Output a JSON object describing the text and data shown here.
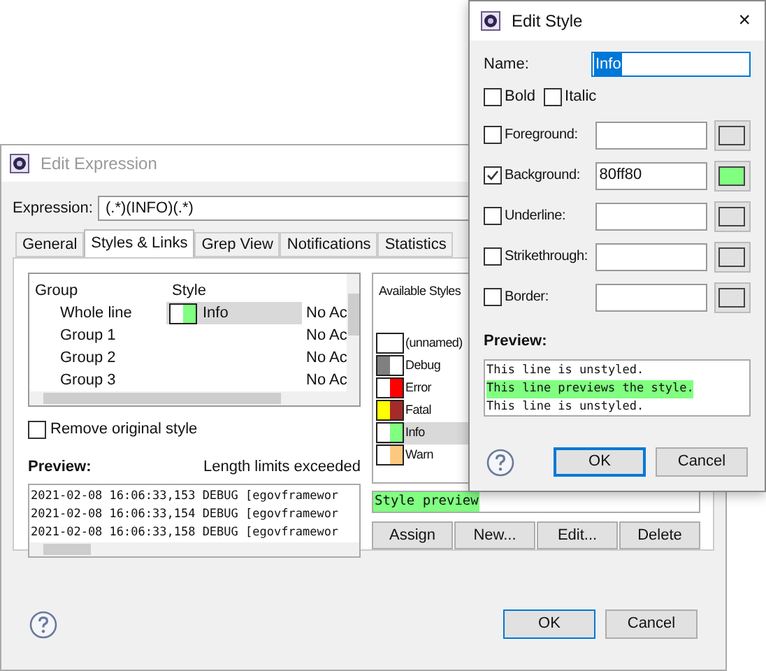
{
  "edit_expression": {
    "title": "Edit Expression",
    "expression_label": "Expression:",
    "expression_value": "(.*)(INFO)(.*)",
    "tabs": [
      {
        "label": "General",
        "selected": false
      },
      {
        "label": "Styles & Links",
        "selected": true
      },
      {
        "label": "Grep View",
        "selected": false
      },
      {
        "label": "Notifications",
        "selected": false
      },
      {
        "label": "Statistics",
        "selected": false
      }
    ],
    "groups_table": {
      "columns": [
        "Group",
        "Style"
      ],
      "rows": [
        {
          "group": "Whole line",
          "style": "Info",
          "swatch": [
            {
              "color": "#ffffff"
            },
            {
              "color": "#80ff80"
            }
          ],
          "column_3": "No Ac",
          "selected": true
        },
        {
          "group": "Group 1",
          "column_3": "No Ac",
          "selected": false
        },
        {
          "group": "Group 2",
          "column_3": "No Ac",
          "selected": false
        },
        {
          "group": "Group 3",
          "column_3": "No Ac",
          "selected": false
        }
      ]
    },
    "available_styles": {
      "title": "Available Styles",
      "items": [
        {
          "name": "(unnamed)",
          "swatch": [
            {
              "color": "#ffffff"
            },
            {
              "color": "#ffffff"
            }
          ],
          "selected": false
        },
        {
          "name": "Debug",
          "swatch": [
            {
              "color": "#808080"
            },
            {
              "color": "#ffffff"
            }
          ],
          "selected": false
        },
        {
          "name": "Error",
          "swatch": [
            {
              "color": "#ffffff"
            },
            {
              "color": "#ff0000"
            }
          ],
          "selected": false
        },
        {
          "name": "Fatal",
          "swatch": [
            {
              "color": "#ffff00"
            },
            {
              "color": "#a52a2a"
            }
          ],
          "selected": false
        },
        {
          "name": "Info",
          "swatch": [
            {
              "color": "#ffffff"
            },
            {
              "color": "#80ff80"
            }
          ],
          "selected": true
        },
        {
          "name": "Warn",
          "swatch": [
            {
              "color": "#ffffff"
            },
            {
              "color": "#ffc880"
            }
          ],
          "selected": false
        }
      ]
    },
    "remove_original_style": {
      "label": "Remove original style",
      "checked": false
    },
    "preview_label": "Preview:",
    "length_notice": "Length limits exceeded",
    "preview_lines": [
      "2021-02-08 16:06:33,153 DEBUG [egovframewor",
      "2021-02-08 16:06:33,154 DEBUG [egovframewor",
      "2021-02-08 16:06:33,158 DEBUG [egovframewor"
    ],
    "style_preview": {
      "text": "Style preview",
      "color": "#80ff80"
    },
    "style_buttons": [
      "Assign",
      "New...",
      "Edit...",
      "Delete"
    ],
    "buttons": [
      "OK",
      "Cancel"
    ]
  },
  "edit_style": {
    "title": "Edit Style",
    "close": "×",
    "name_label": "Name:",
    "name_value": "Info",
    "font_options": [
      {
        "label": "Bold",
        "checked": false
      },
      {
        "label": "Italic",
        "checked": false
      }
    ],
    "attributes": [
      {
        "label": "Foreground:",
        "checked": false,
        "color": "#e1e1e1"
      },
      {
        "label": "Background:",
        "checked": true,
        "value": "80ff80",
        "color": "#80ff80"
      },
      {
        "label": "Underline:",
        "checked": false,
        "color": "#e1e1e1"
      },
      {
        "label": "Strikethrough:",
        "checked": false,
        "color": "#e1e1e1"
      },
      {
        "label": "Border:",
        "checked": false,
        "color": "#e1e1e1"
      }
    ],
    "preview_label": "Preview:",
    "preview_lines": [
      {
        "text": "This line is unstyled.",
        "styled": false
      },
      {
        "text": "This line previews the style.",
        "styled": true
      },
      {
        "text": "This line is unstyled.",
        "styled": false
      }
    ],
    "buttons": [
      {
        "label": "OK",
        "default": true
      },
      {
        "label": "Cancel",
        "default": false
      }
    ]
  }
}
